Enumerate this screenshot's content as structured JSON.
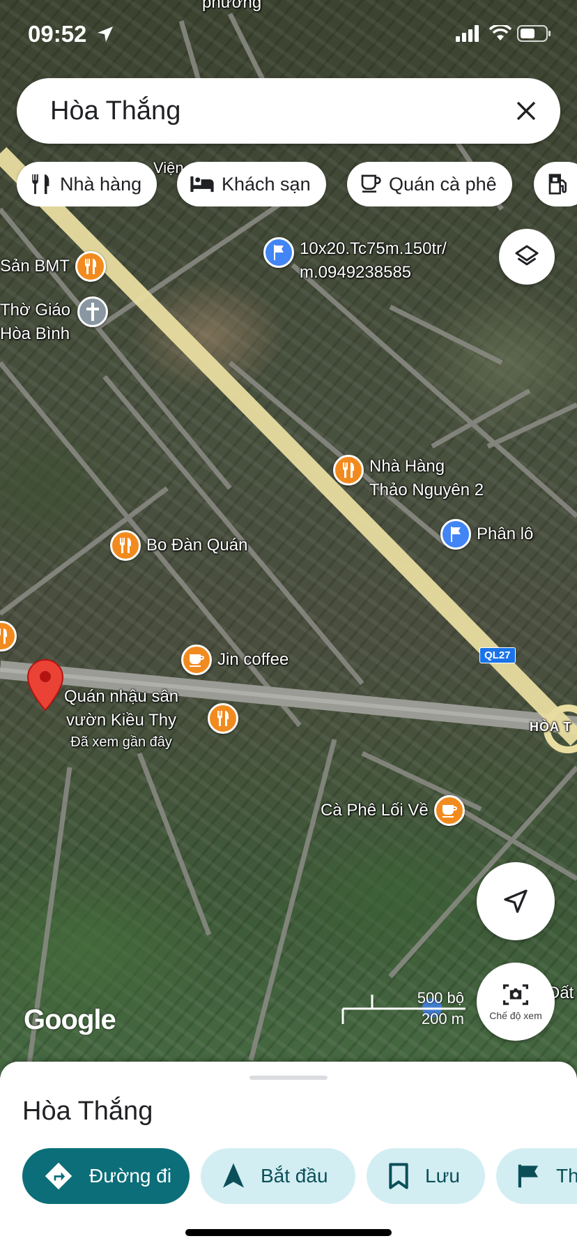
{
  "status_bar": {
    "time": "09:52"
  },
  "search": {
    "query": "Hòa Thắng"
  },
  "chips": [
    {
      "label": "Nhà hàng",
      "icon": "restaurant-icon"
    },
    {
      "label": "Khách sạn",
      "icon": "hotel-icon"
    },
    {
      "label": "Quán cà phê",
      "icon": "coffee-icon"
    },
    {
      "label": "",
      "icon": "gas-station-icon"
    }
  ],
  "map": {
    "pois": [
      {
        "name": "Sản BMT",
        "type": "food"
      },
      {
        "name": "Thờ Giáo",
        "type": "church"
      },
      {
        "name": "Hòa Bình",
        "type": "church"
      },
      {
        "name": "10x20.Tc75m.150tr/",
        "type": "flag"
      },
      {
        "name": "m.0949238585",
        "type": "flag"
      },
      {
        "name": "Nhà Hàng",
        "type": "food"
      },
      {
        "name": "Thảo Nguyên 2",
        "type": "food"
      },
      {
        "name": "Phân lô",
        "type": "flag"
      },
      {
        "name": "Bo Đàn Quán",
        "type": "food"
      },
      {
        "name": "Jin coffee",
        "type": "cafe"
      },
      {
        "name": "Quán nhậu sân",
        "type": "food"
      },
      {
        "name": "vườn Kiều Thy",
        "type": "food"
      },
      {
        "name": "Đã xem gần đây",
        "type": "note"
      },
      {
        "name": "Cà Phê Lối Về",
        "type": "cafe"
      },
      {
        "name": "Đất",
        "type": "text"
      },
      {
        "name": "HÒA T",
        "type": "text"
      },
      {
        "name": "Viện",
        "type": "text"
      },
      {
        "name": "phường",
        "type": "text"
      }
    ],
    "road_shield": "QL27",
    "logo": "Google",
    "scale": {
      "top": "500 bộ",
      "bottom": "200 m"
    },
    "view_mode_label": "Chế độ xem"
  },
  "sheet": {
    "title": "Hòa Thắng",
    "actions": [
      {
        "label": "Đường đi",
        "style": "primary"
      },
      {
        "label": "Bắt đầu",
        "style": "secondary"
      },
      {
        "label": "Lưu",
        "style": "secondary"
      },
      {
        "label": "Th",
        "style": "secondary"
      }
    ]
  },
  "colors": {
    "accent": "#0b6e79",
    "action_secondary": "#d3eef3",
    "poi_orange": "#f28b1f",
    "poi_blue": "#4285f4",
    "pin_red": "#ea4335"
  }
}
